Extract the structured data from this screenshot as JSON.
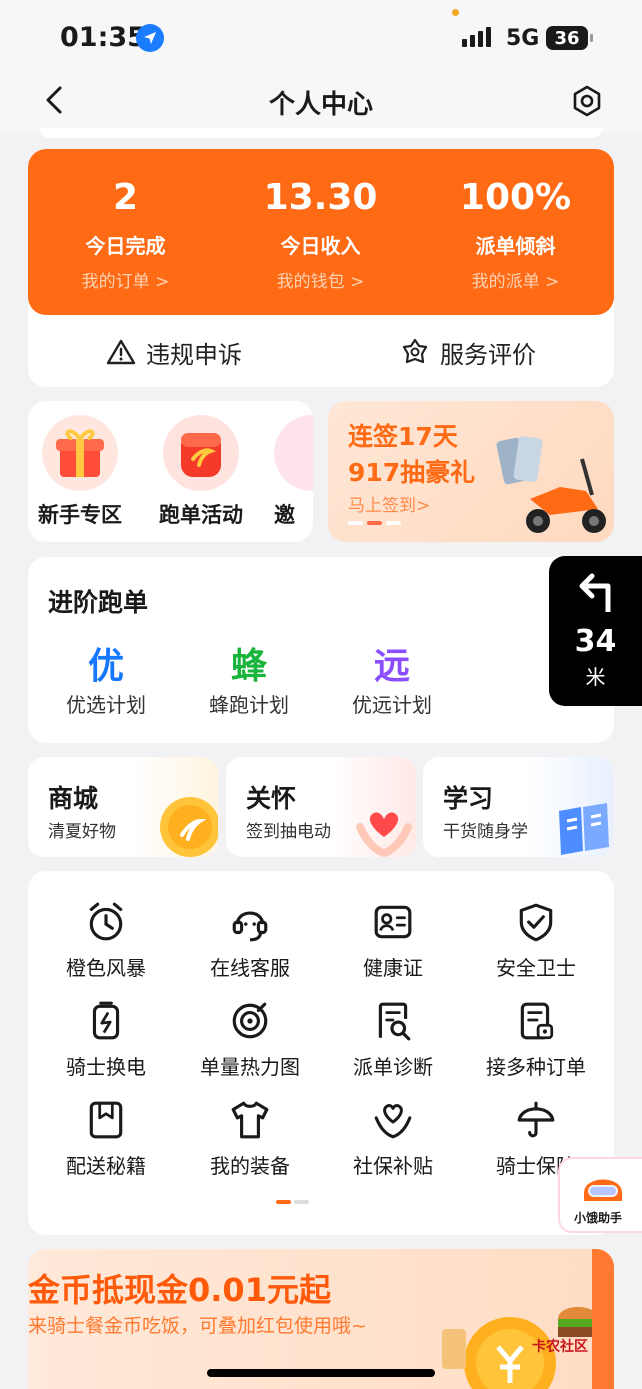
{
  "status_bar": {
    "time": "01:35",
    "network": "5G",
    "battery": "36"
  },
  "header": {
    "title": "个人中心"
  },
  "stats": [
    {
      "value": "2",
      "label": "今日完成",
      "link": "我的订单 >"
    },
    {
      "value": "13.30",
      "label": "今日收入",
      "link": "我的钱包 >"
    },
    {
      "value": "100%",
      "label": "派单倾斜",
      "link": "我的派单 >"
    }
  ],
  "stats_actions": {
    "appeal": "违规申诉",
    "rating": "服务评价"
  },
  "activities": [
    {
      "label": "新手专区",
      "icon": "gift-icon"
    },
    {
      "label": "跑单活动",
      "icon": "red-bag-icon"
    },
    {
      "label": "邀",
      "icon": "invite-icon"
    }
  ],
  "promo": {
    "line1": "连签17天",
    "line2": "917抽豪礼",
    "sub": "马上签到>"
  },
  "advanced": {
    "title": "进阶跑单",
    "items": [
      {
        "glyph": "优",
        "label": "优选计划",
        "color": "#1677ff"
      },
      {
        "glyph": "蜂",
        "label": "蜂跑计划",
        "color": "#19b43c"
      },
      {
        "glyph": "远",
        "label": "优远计划",
        "color": "#8a4dff"
      }
    ]
  },
  "nav_widget": {
    "distance": "34",
    "unit": "米"
  },
  "shortcuts": [
    {
      "title": "商城",
      "sub": "清夏好物"
    },
    {
      "title": "关怀",
      "sub": "签到抽电动"
    },
    {
      "title": "学习",
      "sub": "干货随身学"
    }
  ],
  "grid": [
    {
      "label": "橙色风暴",
      "icon": "alarm-clock-icon"
    },
    {
      "label": "在线客服",
      "icon": "headset-icon"
    },
    {
      "label": "健康证",
      "icon": "id-card-icon"
    },
    {
      "label": "安全卫士",
      "icon": "shield-icon"
    },
    {
      "label": "骑士换电",
      "icon": "battery-swap-icon"
    },
    {
      "label": "单量热力图",
      "icon": "heatmap-icon"
    },
    {
      "label": "派单诊断",
      "icon": "diagnosis-icon"
    },
    {
      "label": "接多种订单",
      "icon": "multi-order-icon"
    },
    {
      "label": "配送秘籍",
      "icon": "book-icon"
    },
    {
      "label": "我的装备",
      "icon": "tshirt-icon"
    },
    {
      "label": "社保补贴",
      "icon": "heart-hands-icon"
    },
    {
      "label": "骑士保险",
      "icon": "umbrella-icon"
    }
  ],
  "assistant": {
    "label": "小饿助手"
  },
  "banner": {
    "title": "金币抵现金0.01元起",
    "sub": "来骑士餐金币吃饭，可叠加红包使用哦~"
  },
  "watermark": {
    "text": "卡农社区"
  },
  "colors": {
    "accent": "#ff6a14",
    "page_bg": "#f2f2f4"
  }
}
